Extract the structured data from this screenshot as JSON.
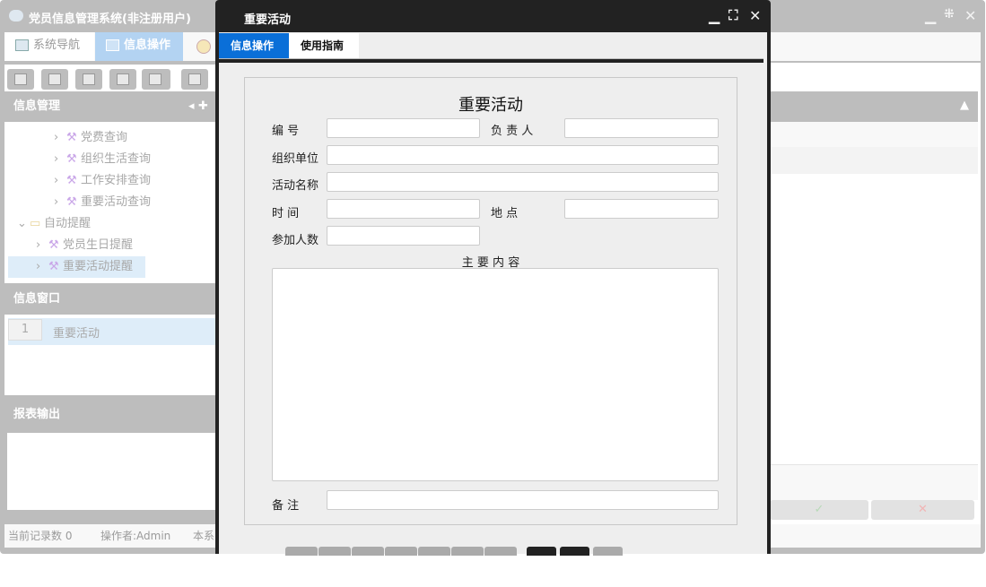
{
  "app": {
    "title": "党员信息管理系统(非注册用户)",
    "tabs": [
      {
        "label": "系统导航"
      },
      {
        "label": "信息操作"
      }
    ]
  },
  "left": {
    "info_mgmt": "信息管理",
    "tree": [
      {
        "label": "党费查询",
        "level": 2
      },
      {
        "label": "组织生活查询",
        "level": 2
      },
      {
        "label": "工作安排查询",
        "level": 2
      },
      {
        "label": "重要活动查询",
        "level": 2
      },
      {
        "label": "自动提醒",
        "level": 0,
        "folder": true
      },
      {
        "label": "党员生日提醒",
        "level": 1
      },
      {
        "label": "重要活动提醒",
        "level": 1,
        "selected": true
      }
    ],
    "info_window": "信息窗口",
    "windows": [
      {
        "index": "1",
        "label": "重要活动"
      }
    ],
    "report": "报表输出"
  },
  "status": {
    "records": "当前记录数 0",
    "operator": "操作者:Admin",
    "extra": "本系"
  },
  "modal": {
    "title": "重要活动",
    "tabs": [
      {
        "label": "信息操作",
        "active": true
      },
      {
        "label": "使用指南"
      }
    ],
    "form": {
      "heading": "重要活动",
      "fields": {
        "number": "编 号",
        "owner": "负 责 人",
        "org": "组织单位",
        "activity": "活动名称",
        "time": "时 间",
        "place": "地 点",
        "count": "参加人数",
        "content": "主 要 内 容",
        "remark": "备 注"
      }
    }
  },
  "right": {
    "ok": "✓",
    "cancel": "✕"
  },
  "colors": {
    "accent": "#0a6fd8",
    "overlay_gray": "#bdbdbd",
    "modal_dark": "#222222"
  }
}
